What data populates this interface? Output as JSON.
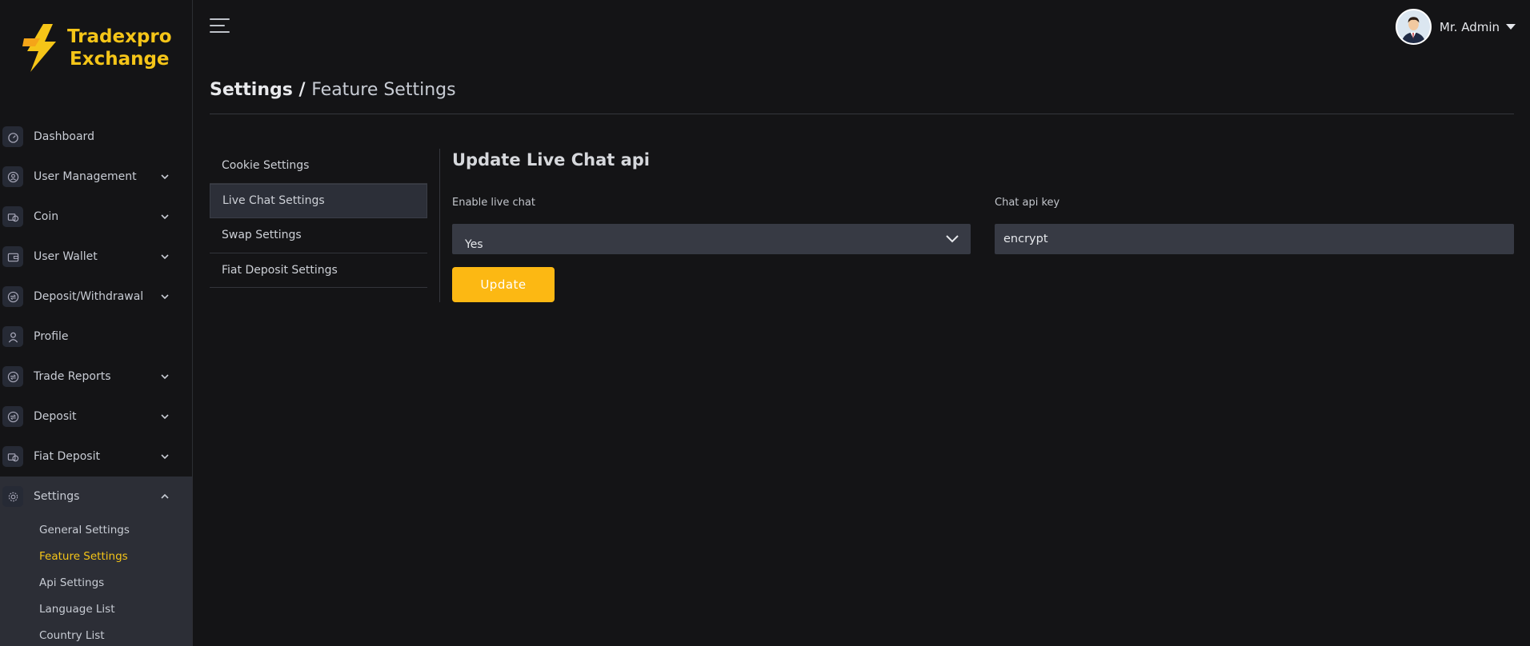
{
  "brand": {
    "line1": "Tradexpro",
    "line2": "Exchange",
    "color": "#f5c518"
  },
  "sidebar": {
    "items": [
      {
        "label": "Dashboard",
        "icon": "speedometer-icon",
        "expandable": false
      },
      {
        "label": "User Management",
        "icon": "user-circle-icon",
        "expandable": true
      },
      {
        "label": "Coin",
        "icon": "coin-icon",
        "expandable": true
      },
      {
        "label": "User Wallet",
        "icon": "wallet-icon",
        "expandable": true
      },
      {
        "label": "Deposit/Withdrawal",
        "icon": "exchange-icon",
        "expandable": true
      },
      {
        "label": "Profile",
        "icon": "profile-icon",
        "expandable": false
      },
      {
        "label": "Trade Reports",
        "icon": "exchange-icon",
        "expandable": true
      },
      {
        "label": "Deposit",
        "icon": "exchange-icon",
        "expandable": true
      },
      {
        "label": "Fiat Deposit",
        "icon": "coin-icon",
        "expandable": true
      }
    ],
    "settings": {
      "label": "Settings",
      "icon": "gear-icon",
      "sub_items": [
        {
          "label": "General Settings",
          "active": false
        },
        {
          "label": "Feature Settings",
          "active": true
        },
        {
          "label": "Api Settings",
          "active": false
        },
        {
          "label": "Language List",
          "active": false
        },
        {
          "label": "Country List",
          "active": false
        }
      ]
    }
  },
  "header": {
    "user_name": "Mr. Admin"
  },
  "breadcrumb": {
    "parent": "Settings /",
    "current": "Feature Settings"
  },
  "feature_menu": [
    {
      "label": "Cookie Settings",
      "active": false
    },
    {
      "label": "Live Chat Settings",
      "active": true
    },
    {
      "label": "Swap Settings",
      "active": false
    },
    {
      "label": "Fiat Deposit Settings",
      "active": false
    }
  ],
  "form": {
    "title": "Update Live Chat api",
    "enable_label": "Enable live chat",
    "enable_value": "Yes",
    "api_key_label": "Chat api key",
    "api_key_value": "encrypt",
    "submit_label": "Update"
  },
  "colors": {
    "accent": "#fcb813",
    "background": "#141416",
    "active_bg": "#2c2e36",
    "input_bg": "#373a44"
  }
}
